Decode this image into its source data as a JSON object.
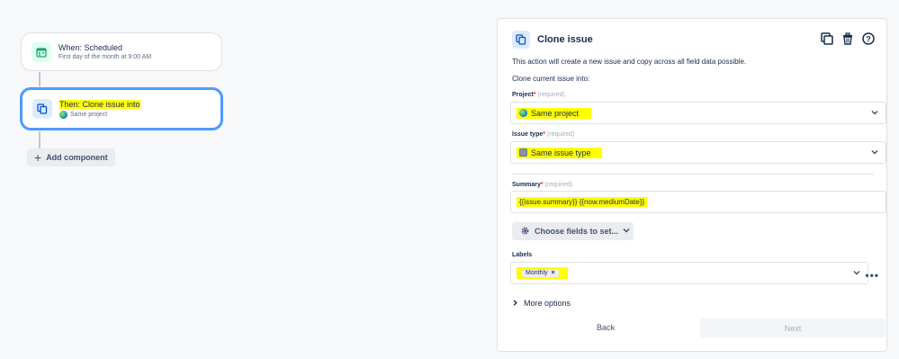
{
  "flow": {
    "trigger": {
      "title": "When: Scheduled",
      "subtitle": "First day of the month at 9:00 AM",
      "icon": "calendar-icon"
    },
    "action": {
      "title": "Then: Clone issue into",
      "subtitle": "Same project",
      "icon": "clone-icon"
    },
    "add_component_label": "Add component"
  },
  "panel": {
    "title": "Clone issue",
    "description": "This action will create a new issue and copy across all field data possible.",
    "subheading": "Clone current issue into:",
    "required_text": "(required)",
    "project": {
      "label": "Project",
      "value": "Same project"
    },
    "issue_type": {
      "label": "Issue type",
      "value": "Same issue type"
    },
    "summary": {
      "label": "Summary",
      "value": "{{issue.summary}} {{now.mediumDate}}"
    },
    "choose_fields_label": "Choose fields to set...",
    "labels": {
      "label": "Labels",
      "tags": [
        "Monthly"
      ]
    },
    "more_options_label": "More options",
    "back_label": "Back",
    "next_label": "Next"
  },
  "colors": {
    "highlight": "#ffff00",
    "selected_border": "#4c9aff",
    "required": "#de350b"
  }
}
